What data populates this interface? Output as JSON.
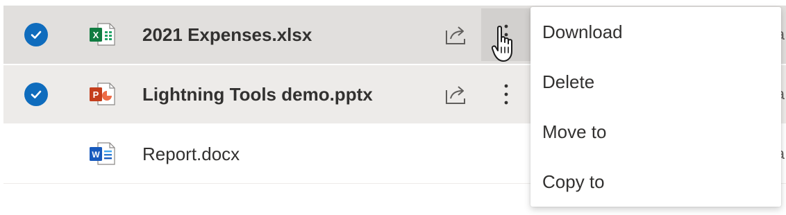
{
  "files": [
    {
      "name": "2021 Expenses.xlsx",
      "type": "excel",
      "selected": true
    },
    {
      "name": "Lightning Tools demo.pptx",
      "type": "powerpoint",
      "selected": true
    },
    {
      "name": "Report.docx",
      "type": "word",
      "selected": false
    }
  ],
  "context_menu": {
    "items": [
      "Download",
      "Delete",
      "Move to",
      "Copy to"
    ]
  },
  "truncated_edge_text": "a",
  "colors": {
    "accent": "#0f6cbd",
    "excel": "#107c41",
    "powerpoint": "#c43e1c",
    "word": "#185abd",
    "row_selected": "#edebe9",
    "row_hover": "#e1dfdd"
  }
}
